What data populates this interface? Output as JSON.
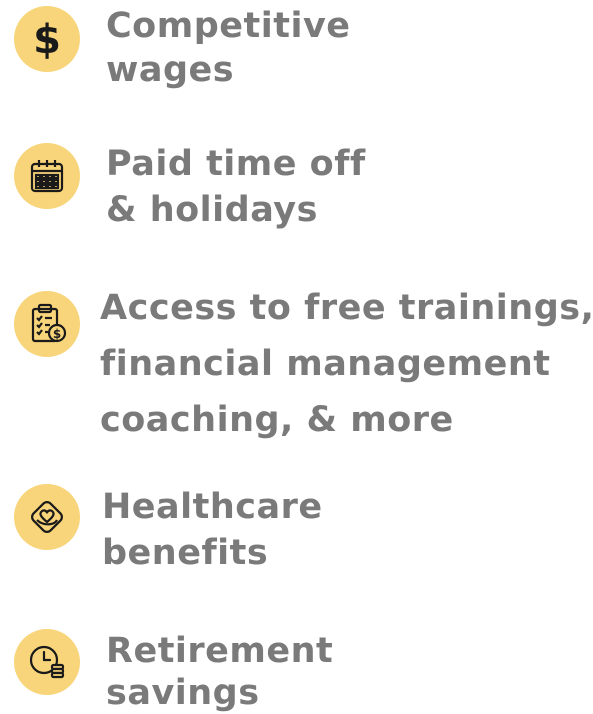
{
  "benefits": [
    {
      "icon": "dollar-icon",
      "lines": [
        "Competitive",
        "wages"
      ]
    },
    {
      "icon": "calendar-icon",
      "lines": [
        "Paid time off",
        "& holidays"
      ]
    },
    {
      "icon": "clipboard-dollar-icon",
      "lines": [
        "Access to free trainings,",
        "financial management",
        "coaching, & more"
      ]
    },
    {
      "icon": "hand-heart-icon",
      "lines": [
        "Healthcare",
        "benefits"
      ]
    },
    {
      "icon": "clock-coins-icon",
      "lines": [
        "Retirement",
        "savings"
      ]
    }
  ],
  "colors": {
    "icon_background": "#f8d57a",
    "icon_stroke": "#1a1a1a",
    "text": "#7a7a7a"
  }
}
